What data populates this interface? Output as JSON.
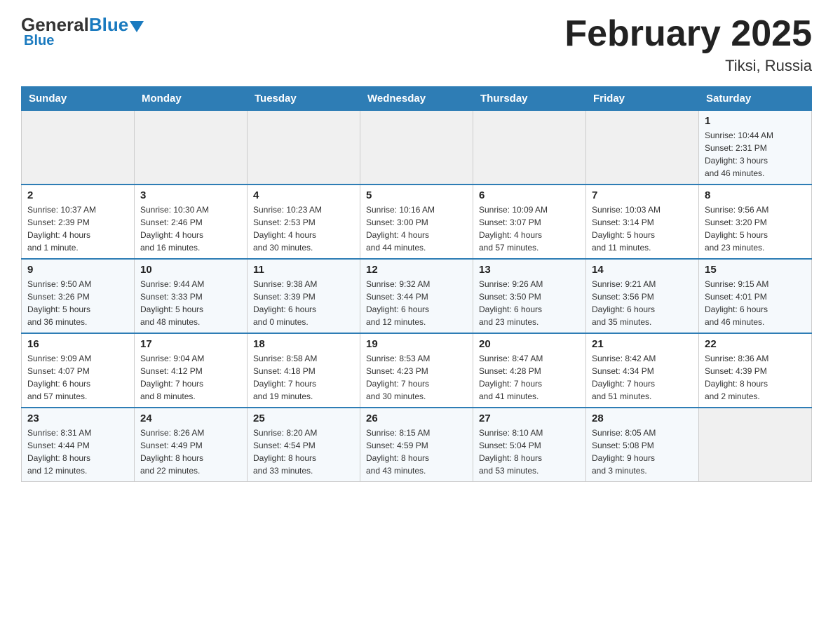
{
  "header": {
    "logo": {
      "general": "General",
      "blue": "Blue",
      "underline": "Blue"
    },
    "title": "February 2025",
    "location": "Tiksi, Russia"
  },
  "weekdays": [
    "Sunday",
    "Monday",
    "Tuesday",
    "Wednesday",
    "Thursday",
    "Friday",
    "Saturday"
  ],
  "weeks": [
    [
      {
        "day": "",
        "info": ""
      },
      {
        "day": "",
        "info": ""
      },
      {
        "day": "",
        "info": ""
      },
      {
        "day": "",
        "info": ""
      },
      {
        "day": "",
        "info": ""
      },
      {
        "day": "",
        "info": ""
      },
      {
        "day": "1",
        "info": "Sunrise: 10:44 AM\nSunset: 2:31 PM\nDaylight: 3 hours\nand 46 minutes."
      }
    ],
    [
      {
        "day": "2",
        "info": "Sunrise: 10:37 AM\nSunset: 2:39 PM\nDaylight: 4 hours\nand 1 minute."
      },
      {
        "day": "3",
        "info": "Sunrise: 10:30 AM\nSunset: 2:46 PM\nDaylight: 4 hours\nand 16 minutes."
      },
      {
        "day": "4",
        "info": "Sunrise: 10:23 AM\nSunset: 2:53 PM\nDaylight: 4 hours\nand 30 minutes."
      },
      {
        "day": "5",
        "info": "Sunrise: 10:16 AM\nSunset: 3:00 PM\nDaylight: 4 hours\nand 44 minutes."
      },
      {
        "day": "6",
        "info": "Sunrise: 10:09 AM\nSunset: 3:07 PM\nDaylight: 4 hours\nand 57 minutes."
      },
      {
        "day": "7",
        "info": "Sunrise: 10:03 AM\nSunset: 3:14 PM\nDaylight: 5 hours\nand 11 minutes."
      },
      {
        "day": "8",
        "info": "Sunrise: 9:56 AM\nSunset: 3:20 PM\nDaylight: 5 hours\nand 23 minutes."
      }
    ],
    [
      {
        "day": "9",
        "info": "Sunrise: 9:50 AM\nSunset: 3:26 PM\nDaylight: 5 hours\nand 36 minutes."
      },
      {
        "day": "10",
        "info": "Sunrise: 9:44 AM\nSunset: 3:33 PM\nDaylight: 5 hours\nand 48 minutes."
      },
      {
        "day": "11",
        "info": "Sunrise: 9:38 AM\nSunset: 3:39 PM\nDaylight: 6 hours\nand 0 minutes."
      },
      {
        "day": "12",
        "info": "Sunrise: 9:32 AM\nSunset: 3:44 PM\nDaylight: 6 hours\nand 12 minutes."
      },
      {
        "day": "13",
        "info": "Sunrise: 9:26 AM\nSunset: 3:50 PM\nDaylight: 6 hours\nand 23 minutes."
      },
      {
        "day": "14",
        "info": "Sunrise: 9:21 AM\nSunset: 3:56 PM\nDaylight: 6 hours\nand 35 minutes."
      },
      {
        "day": "15",
        "info": "Sunrise: 9:15 AM\nSunset: 4:01 PM\nDaylight: 6 hours\nand 46 minutes."
      }
    ],
    [
      {
        "day": "16",
        "info": "Sunrise: 9:09 AM\nSunset: 4:07 PM\nDaylight: 6 hours\nand 57 minutes."
      },
      {
        "day": "17",
        "info": "Sunrise: 9:04 AM\nSunset: 4:12 PM\nDaylight: 7 hours\nand 8 minutes."
      },
      {
        "day": "18",
        "info": "Sunrise: 8:58 AM\nSunset: 4:18 PM\nDaylight: 7 hours\nand 19 minutes."
      },
      {
        "day": "19",
        "info": "Sunrise: 8:53 AM\nSunset: 4:23 PM\nDaylight: 7 hours\nand 30 minutes."
      },
      {
        "day": "20",
        "info": "Sunrise: 8:47 AM\nSunset: 4:28 PM\nDaylight: 7 hours\nand 41 minutes."
      },
      {
        "day": "21",
        "info": "Sunrise: 8:42 AM\nSunset: 4:34 PM\nDaylight: 7 hours\nand 51 minutes."
      },
      {
        "day": "22",
        "info": "Sunrise: 8:36 AM\nSunset: 4:39 PM\nDaylight: 8 hours\nand 2 minutes."
      }
    ],
    [
      {
        "day": "23",
        "info": "Sunrise: 8:31 AM\nSunset: 4:44 PM\nDaylight: 8 hours\nand 12 minutes."
      },
      {
        "day": "24",
        "info": "Sunrise: 8:26 AM\nSunset: 4:49 PM\nDaylight: 8 hours\nand 22 minutes."
      },
      {
        "day": "25",
        "info": "Sunrise: 8:20 AM\nSunset: 4:54 PM\nDaylight: 8 hours\nand 33 minutes."
      },
      {
        "day": "26",
        "info": "Sunrise: 8:15 AM\nSunset: 4:59 PM\nDaylight: 8 hours\nand 43 minutes."
      },
      {
        "day": "27",
        "info": "Sunrise: 8:10 AM\nSunset: 5:04 PM\nDaylight: 8 hours\nand 53 minutes."
      },
      {
        "day": "28",
        "info": "Sunrise: 8:05 AM\nSunset: 5:08 PM\nDaylight: 9 hours\nand 3 minutes."
      },
      {
        "day": "",
        "info": ""
      }
    ]
  ]
}
